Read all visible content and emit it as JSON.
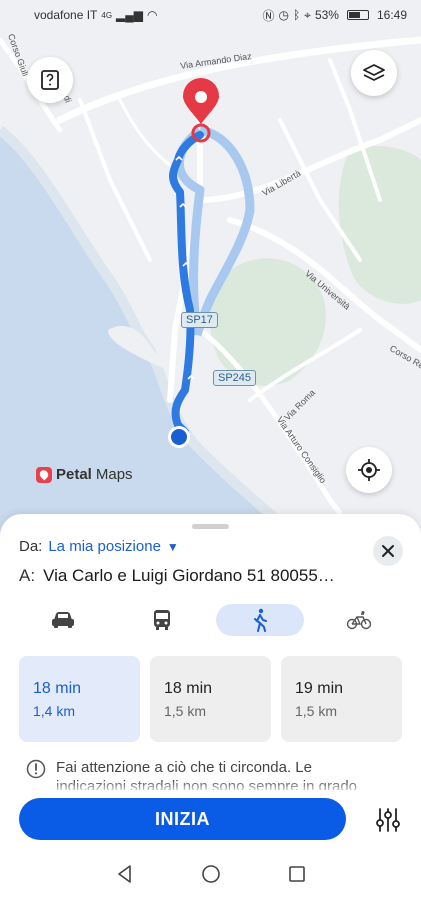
{
  "status_bar": {
    "carrier": "vodafone IT",
    "network": "4G",
    "battery": "53%",
    "time": "16:49"
  },
  "map": {
    "road_labels": {
      "via_armando_diaz": "Via Armando Diaz",
      "via_liberta": "Via Libertà",
      "via_universita": "Via Università",
      "corso_re": "Corso Re",
      "via_roma": "Via Roma",
      "via_arturo_consiglio": "Via Arturo Consiglio",
      "corso_giulio": "Corso Giuli",
      "corso_giulio_end": "di"
    },
    "shields": {
      "sp17": "SP17",
      "sp245": "SP245"
    },
    "brand_strong": "Petal",
    "brand_rest": "Maps",
    "colors": {
      "route": "#2f7ae0",
      "route_alt": "#a8c8f0",
      "destination": "#e63946",
      "sea": "#c9d9ee",
      "park": "#dbe8dc"
    },
    "icons": [
      "guide-icon",
      "layers-icon",
      "locate-icon"
    ]
  },
  "sheet": {
    "from_label": "Da:",
    "from_value": "La mia posizione",
    "to_label": "A:",
    "to_value": "Via Carlo e Luigi Giordano 51 80055…",
    "modes": [
      "car",
      "transit",
      "walk",
      "bike"
    ],
    "active_mode": "walk",
    "routes": [
      {
        "time": "18 min",
        "distance": "1,4 km"
      },
      {
        "time": "18 min",
        "distance": "1,5 km"
      },
      {
        "time": "19 min",
        "distance": "1,5 km"
      }
    ],
    "warning": "Fai attenzione a ciò che ti circonda. Le indicazioni stradali non sono sempre in grado",
    "start_label": "INIZIA",
    "accent": "#0a5ce6"
  }
}
